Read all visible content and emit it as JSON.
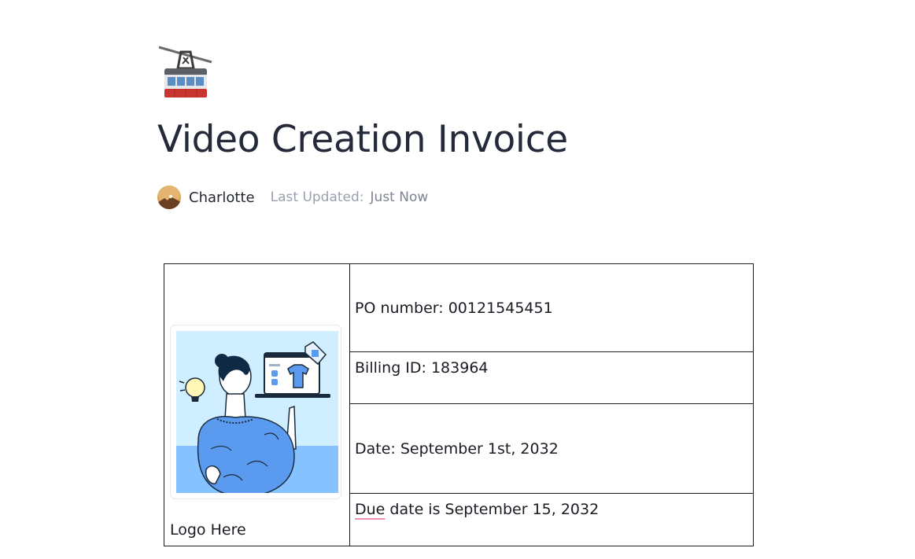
{
  "page": {
    "icon": "aerial-tramway-icon",
    "title": "Video Creation Invoice"
  },
  "meta": {
    "author": "Charlotte",
    "updated_label": "Last Updated:",
    "updated_value": "Just Now"
  },
  "invoice": {
    "logo_caption": "Logo Here",
    "po_number": "PO number: 00121545451",
    "billing_id": "Billing ID: 183964",
    "date": "Date: September 1st, 2032",
    "due_word": "Due",
    "due_rest": " date is September 15, 2032"
  },
  "colors": {
    "title": "#252a3b",
    "meta_label": "#9aa1ae",
    "spellcheck_underline": "#ef8fb4",
    "illustration_sky": "#cfeeff",
    "illustration_blue": "#5b9bef"
  }
}
